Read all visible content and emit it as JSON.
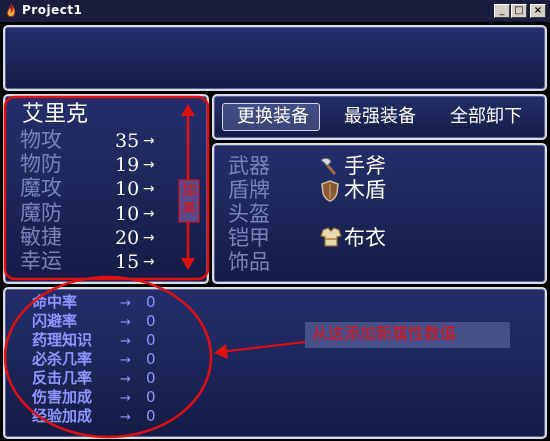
{
  "window": {
    "title": "Project1",
    "buttons": {
      "minimize": "_",
      "maximize": "□",
      "close": "×"
    }
  },
  "character": {
    "name": "艾里克",
    "stats": [
      {
        "label": "物攻",
        "value": "35",
        "arrow": "→"
      },
      {
        "label": "物防",
        "value": "19",
        "arrow": "→"
      },
      {
        "label": "魔攻",
        "value": "10",
        "arrow": "→"
      },
      {
        "label": "魔防",
        "value": "10",
        "arrow": "→"
      },
      {
        "label": "敏捷",
        "value": "20",
        "arrow": "→"
      },
      {
        "label": "幸运",
        "value": "15",
        "arrow": "→"
      }
    ]
  },
  "commands": [
    "更换装备",
    "最强装备",
    "全部卸下"
  ],
  "equipment": [
    {
      "slot": "武器",
      "item": "手斧",
      "icon": "axe-icon"
    },
    {
      "slot": "盾牌",
      "item": "木盾",
      "icon": "shield-icon"
    },
    {
      "slot": "头盔",
      "item": "",
      "icon": ""
    },
    {
      "slot": "铠甲",
      "item": "布衣",
      "icon": "armor-icon"
    },
    {
      "slot": "饰品",
      "item": "",
      "icon": ""
    }
  ],
  "extra_stats": [
    {
      "label": "命中率",
      "arrow": "→",
      "value": "0"
    },
    {
      "label": "闪避率",
      "arrow": "→",
      "value": "0"
    },
    {
      "label": "药理知识",
      "arrow": "→",
      "value": "0"
    },
    {
      "label": "必杀几率",
      "arrow": "→",
      "value": "0"
    },
    {
      "label": "反击几率",
      "arrow": "→",
      "value": "0"
    },
    {
      "label": "伤害加成",
      "arrow": "→",
      "value": "0"
    },
    {
      "label": "经验加成",
      "arrow": "→",
      "value": "0"
    }
  ],
  "annotations": {
    "vertical_label": [
      "加",
      "离"
    ],
    "callout": "从这添加新属性数值"
  },
  "colors": {
    "window_bg": "#1e275b",
    "window_border": "#d7dbe6",
    "label_text": "#7a84b8",
    "extra_text": "#8f96ff",
    "annotation": "#e01010",
    "titlebar": "#1b1d3c"
  }
}
